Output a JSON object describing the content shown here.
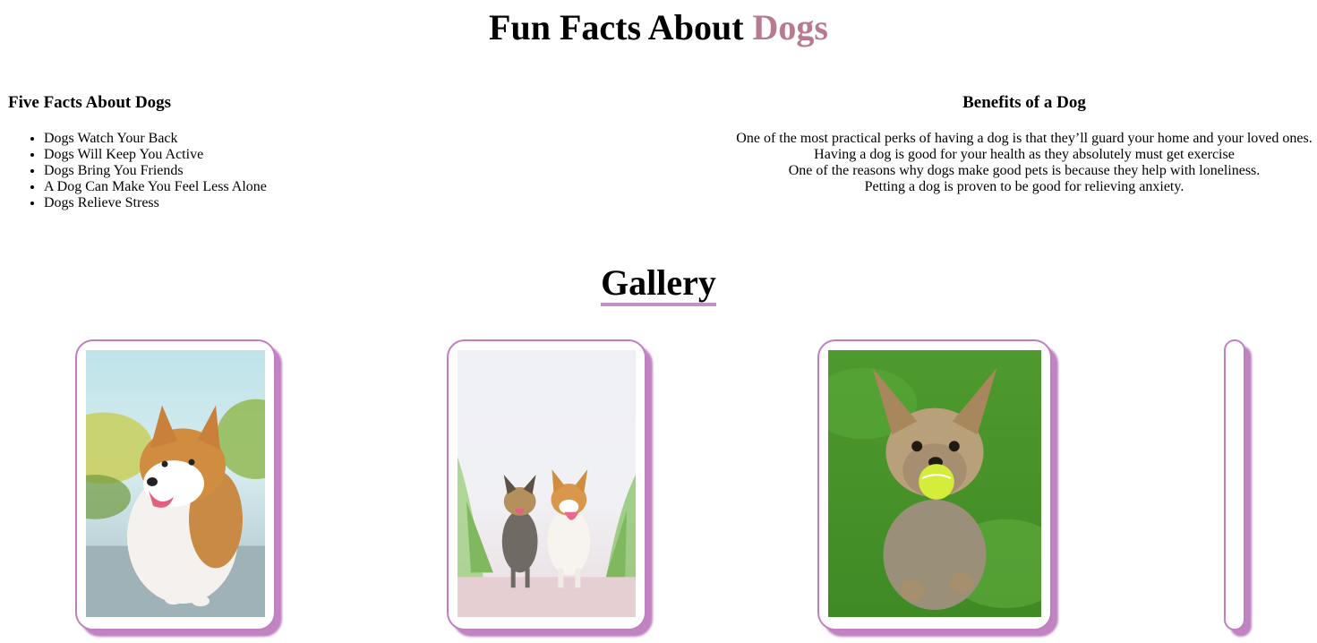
{
  "header": {
    "title_main": "Fun Facts About",
    "title_accent": "Dogs",
    "accent_color": "#b87a91"
  },
  "facts": {
    "heading": "Five Facts About Dogs",
    "items": [
      "Dogs Watch Your Back",
      "Dogs Will Keep You Active",
      "Dogs Bring You Friends",
      "A Dog Can Make You Feel Less Alone",
      "Dogs Relieve Stress"
    ]
  },
  "benefits": {
    "heading": "Benefits of a Dog",
    "lines": [
      "One of the most practical perks of having a dog is that they’ll guard your home and your loved ones.",
      "Having a dog is good for your health as they absolutely must get exercise",
      "One of the reasons why dogs make good pets is because they help with loneliness.",
      "Petting a dog is proven to be good for relieving anxiety."
    ]
  },
  "gallery": {
    "heading": "Gallery",
    "underline_color": "#c490c8",
    "card_border_color": "#c07fbf",
    "cards": [
      {
        "subject": "corgi-photo"
      },
      {
        "subject": "two-dogs-running-photo"
      },
      {
        "subject": "yorkie-with-ball-photo"
      },
      {
        "subject": "partially-visible-card"
      }
    ]
  }
}
